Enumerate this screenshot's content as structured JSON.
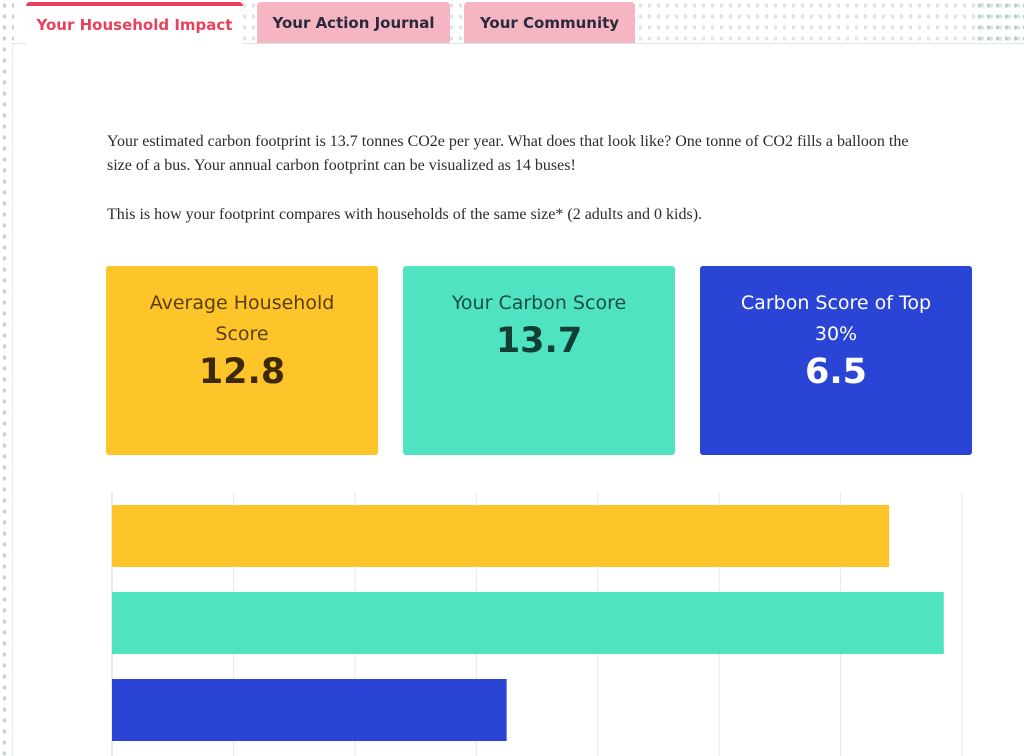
{
  "tabs": [
    {
      "label": "Your Household Impact",
      "active": true
    },
    {
      "label": "Your Action Journal",
      "active": false
    },
    {
      "label": "Your Community",
      "active": false
    }
  ],
  "intro": {
    "footprint_text": "Your estimated carbon footprint is 13.7 tonnes CO2e per year. What does that look like? One tonne of CO2 fills a balloon the size of a bus. Your annual carbon footprint can be visualized as 14 buses!",
    "comparison_text": "This is how your footprint compares with households of the same size* (2 adults and 0 kids)."
  },
  "cards": {
    "average": {
      "label": "Average Household Score",
      "value": "12.8"
    },
    "yours": {
      "label": "Your Carbon Score",
      "value": "13.7"
    },
    "top": {
      "label": "Carbon Score of Top 30%",
      "value": "6.5"
    }
  },
  "colors": {
    "accent": "#e8415d",
    "tab_inactive": "#f5b5c3",
    "average": "#fec52b",
    "yours": "#50e3c2",
    "top": "#2a44d6"
  },
  "chart_data": {
    "type": "bar",
    "orientation": "horizontal",
    "categories": [
      "Average Household Score",
      "Your Carbon Score",
      "Carbon Score of Top 30%"
    ],
    "values": [
      12.8,
      13.7,
      6.5
    ],
    "colors": [
      "#fec52b",
      "#50e3c2",
      "#2a44d6"
    ],
    "xlim": [
      0,
      14
    ],
    "grid": true,
    "legend": "none"
  }
}
